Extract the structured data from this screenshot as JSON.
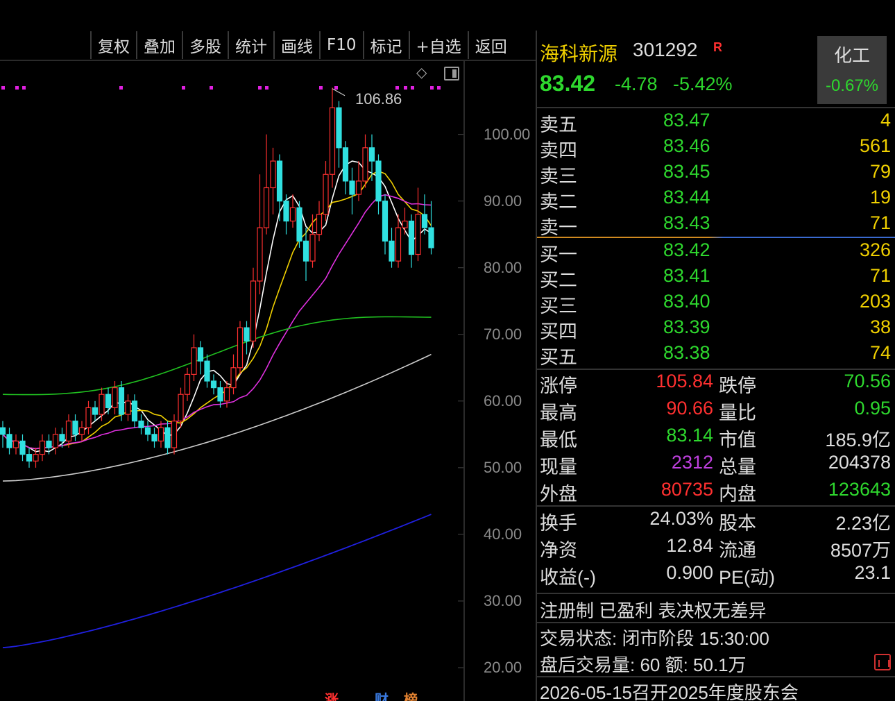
{
  "toolbar": {
    "buttons": [
      "复权",
      "叠加",
      "多股",
      "统计",
      "画线",
      "F10",
      "标记",
      "+自选",
      "返回"
    ]
  },
  "chart": {
    "high_marker": "106.86",
    "y_ticks": [
      "100.00",
      "90.00",
      "80.00",
      "70.00",
      "60.00",
      "50.00",
      "40.00",
      "30.00",
      "20.00"
    ],
    "bottom_tags": [
      "涨",
      "财",
      "榜"
    ]
  },
  "chart_data": {
    "type": "candlestick",
    "ylim": [
      15,
      111
    ],
    "y_ticks": [
      20,
      30,
      40,
      50,
      60,
      70,
      80,
      90,
      100
    ],
    "high_annotation": 106.86,
    "candles": [
      [
        56,
        55,
        57,
        53
      ],
      [
        55,
        53,
        56,
        52
      ],
      [
        53,
        54,
        55,
        52
      ],
      [
        54,
        52,
        55,
        51
      ],
      [
        52,
        51,
        53,
        50
      ],
      [
        51,
        52,
        53,
        50
      ],
      [
        52,
        54,
        55,
        51
      ],
      [
        54,
        53,
        55,
        52
      ],
      [
        53,
        55,
        56,
        52
      ],
      [
        55,
        54,
        56,
        53
      ],
      [
        54,
        57,
        58,
        53
      ],
      [
        57,
        55,
        58,
        54
      ],
      [
        55,
        56,
        57,
        54
      ],
      [
        56,
        59,
        60,
        55
      ],
      [
        59,
        58,
        60,
        57
      ],
      [
        58,
        61,
        62,
        57
      ],
      [
        61,
        59,
        62,
        58
      ],
      [
        59,
        62,
        63,
        58
      ],
      [
        62,
        58,
        63,
        57
      ],
      [
        58,
        60,
        61,
        57
      ],
      [
        60,
        57,
        61,
        56
      ],
      [
        57,
        56,
        58,
        55
      ],
      [
        56,
        55,
        57,
        54
      ],
      [
        55,
        54,
        56,
        53
      ],
      [
        54,
        56,
        57,
        53
      ],
      [
        56,
        53,
        57,
        52
      ],
      [
        53,
        57,
        58,
        52
      ],
      [
        57,
        61,
        62,
        56
      ],
      [
        61,
        64,
        65,
        60
      ],
      [
        64,
        68,
        70,
        63
      ],
      [
        68,
        66,
        69,
        64
      ],
      [
        66,
        63,
        67,
        62
      ],
      [
        63,
        62,
        64,
        61
      ],
      [
        62,
        60,
        63,
        59
      ],
      [
        60,
        62,
        63,
        59
      ],
      [
        62,
        65,
        67,
        61
      ],
      [
        65,
        71,
        72,
        64
      ],
      [
        71,
        69,
        72,
        67
      ],
      [
        69,
        78,
        80,
        68
      ],
      [
        78,
        86,
        94,
        76
      ],
      [
        86,
        92,
        100,
        85
      ],
      [
        92,
        96,
        98,
        88
      ],
      [
        96,
        90,
        97,
        87
      ],
      [
        90,
        87,
        91,
        85
      ],
      [
        87,
        89,
        91,
        86
      ],
      [
        89,
        84,
        90,
        83
      ],
      [
        84,
        81,
        86,
        78
      ],
      [
        81,
        85,
        88,
        80
      ],
      [
        85,
        88,
        90,
        84
      ],
      [
        88,
        94,
        96,
        87
      ],
      [
        94,
        104,
        107,
        92
      ],
      [
        104,
        98,
        105,
        95
      ],
      [
        98,
        93,
        99,
        91
      ],
      [
        93,
        91,
        95,
        88
      ],
      [
        91,
        93,
        96,
        90
      ],
      [
        93,
        98,
        100,
        92
      ],
      [
        98,
        96,
        100,
        93
      ],
      [
        96,
        90,
        97,
        88
      ],
      [
        90,
        84,
        91,
        82
      ],
      [
        84,
        81,
        86,
        80
      ],
      [
        81,
        86,
        88,
        80
      ],
      [
        86,
        87,
        89,
        85
      ],
      [
        87,
        82,
        88,
        80
      ],
      [
        82,
        88,
        92,
        81
      ],
      [
        88,
        86,
        91,
        85
      ],
      [
        86,
        83,
        90,
        82
      ]
    ],
    "ma_series": [
      {
        "color": "#ffffff"
      },
      {
        "color": "#f0d000"
      },
      {
        "color": "#e030e0"
      },
      {
        "color": "#20c020"
      },
      {
        "color": "#cccccc"
      },
      {
        "color": "#2020e0"
      }
    ],
    "colors": {
      "up": "#ff3030",
      "down": "#30e0e0"
    }
  },
  "quote": {
    "name": "海科新源",
    "code": "301292",
    "badge": "R",
    "price": "83.42",
    "change": "-4.78",
    "change_pct": "-5.42%",
    "sector": "化工",
    "sector_change": "-0.67%"
  },
  "order_book": {
    "sell": [
      {
        "label": "卖五",
        "price": "83.47",
        "vol": "4"
      },
      {
        "label": "卖四",
        "price": "83.46",
        "vol": "561"
      },
      {
        "label": "卖三",
        "price": "83.45",
        "vol": "79"
      },
      {
        "label": "卖二",
        "price": "83.44",
        "vol": "19"
      },
      {
        "label": "卖一",
        "price": "83.43",
        "vol": "71"
      }
    ],
    "buy": [
      {
        "label": "买一",
        "price": "83.42",
        "vol": "326"
      },
      {
        "label": "买二",
        "price": "83.41",
        "vol": "71"
      },
      {
        "label": "买三",
        "price": "83.40",
        "vol": "203"
      },
      {
        "label": "买四",
        "price": "83.39",
        "vol": "38"
      },
      {
        "label": "买五",
        "price": "83.38",
        "vol": "74"
      }
    ]
  },
  "stats": {
    "g1": [
      {
        "l1": "涨停",
        "v1": "105.84",
        "c1": "#ff3030",
        "l2": "跌停",
        "v2": "70.56",
        "c2": "#2ed82e"
      },
      {
        "l1": "最高",
        "v1": "90.66",
        "c1": "#ff3030",
        "l2": "量比",
        "v2": "0.95",
        "c2": "#2ed82e"
      },
      {
        "l1": "最低",
        "v1": "83.14",
        "c1": "#2ed82e",
        "l2": "市值",
        "v2": "185.9亿",
        "c2": "#dddddd"
      },
      {
        "l1": "现量",
        "v1": "2312",
        "c1": "#c040e0",
        "l2": "总量",
        "v2": "204378",
        "c2": "#dddddd"
      },
      {
        "l1": "外盘",
        "v1": "80735",
        "c1": "#ff3030",
        "l2": "内盘",
        "v2": "123643",
        "c2": "#2ed82e"
      }
    ],
    "g2": [
      {
        "l1": "换手",
        "v1": "24.03%",
        "c1": "#dddddd",
        "l2": "股本",
        "v2": "2.23亿",
        "c2": "#dddddd"
      },
      {
        "l1": "净资",
        "v1": "12.84",
        "c1": "#dddddd",
        "l2": "流通",
        "v2": "8507万",
        "c2": "#dddddd"
      },
      {
        "l1": "收益(-)",
        "v1": "0.900",
        "c1": "#dddddd",
        "l2": "PE(动)",
        "v2": "23.1",
        "c2": "#dddddd"
      }
    ]
  },
  "info": {
    "flags": "注册制 已盈利 表决权无差异",
    "trade_status": "交易状态: 闭市阶段 15:30:00",
    "after_hours": "盘后交易量: 60  额: 50.1万",
    "notice": "2026-05-15召开2025年度股东会"
  }
}
